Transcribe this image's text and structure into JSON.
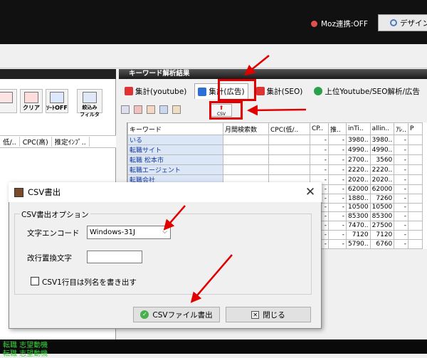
{
  "topbar": {
    "moz_status": "Moz連携:OFF",
    "design_label": "デザイン"
  },
  "left_panel": {
    "buttons": [
      "",
      "クリア",
      "ｿｰﾄOFF",
      "絞込み\nフィルタ"
    ],
    "columns": [
      "低/..",
      "CPC(高)",
      "推定ｲﾝﾌﾟ.."
    ]
  },
  "right_panel": {
    "title": "キーワード解析結果",
    "tabs": [
      {
        "label": "集計(youtube)",
        "icon_color": "#d33"
      },
      {
        "label": "集計(広告)",
        "icon_color": "#2a6fd6"
      },
      {
        "label": "集計(SEO)",
        "icon_color": "#d33"
      },
      {
        "label": "上位Youtube/SEO解析/広告",
        "icon_color": "#2aa04a"
      }
    ],
    "csv_tool": "CSV",
    "grid": {
      "headers": [
        "キーワード",
        "月間検索数",
        "CPC(低/..",
        "CP..",
        "推..",
        "inTi..",
        "allin..",
        "ｱﾚ..",
        "P"
      ],
      "rows": [
        [
          "いる",
          "",
          "",
          "-",
          "-",
          "3980..",
          "3980..",
          "-"
        ],
        [
          "転職サイト",
          "",
          "",
          "-",
          "-",
          "4990..",
          "4990..",
          "-"
        ],
        [
          "転職 松本市",
          "",
          "",
          "-",
          "-",
          "2700..",
          "3560",
          "-"
        ],
        [
          "転職エージェント",
          "",
          "",
          "-",
          "-",
          "2220..",
          "2220..",
          "-"
        ],
        [
          "転職会社",
          "",
          "",
          "-",
          "-",
          "2020..",
          "2020..",
          "-"
        ],
        [
          "",
          "",
          "",
          "-",
          "-",
          "62000",
          "62000",
          "-"
        ],
        [
          "",
          "",
          "",
          "-",
          "-",
          "1880..",
          "7260",
          "-"
        ],
        [
          "",
          "",
          "",
          "-",
          "-",
          "10500",
          "10500",
          "-"
        ],
        [
          "",
          "",
          "",
          "-",
          "-",
          "85300",
          "85300",
          "-"
        ],
        [
          "",
          "",
          "",
          "-",
          "-",
          "7470..",
          "27500",
          "-"
        ],
        [
          "",
          "",
          "",
          "-",
          "-",
          "7120",
          "7120",
          "-"
        ],
        [
          "",
          "",
          "",
          "-",
          "-",
          "5790..",
          "6760",
          "-"
        ]
      ]
    }
  },
  "dialog": {
    "title": "CSV書出",
    "group_label": "CSV書出オプション",
    "encoding_label": "文字エンコード",
    "encoding_value": "Windows-31J",
    "replace_label": "改行置換文字",
    "replace_value": "",
    "checkbox_label": "CSV1行目は列名を書き出す",
    "export_button": "CSVファイル書出",
    "close_button": "閉じる"
  },
  "bottom": {
    "lines": [
      "転職 志望動機",
      "転職 志望動機"
    ]
  },
  "colors": {
    "highlight": "#e00000",
    "keyword_cell_bg": "#dbe6f7",
    "status_text": "#3cd43c"
  }
}
